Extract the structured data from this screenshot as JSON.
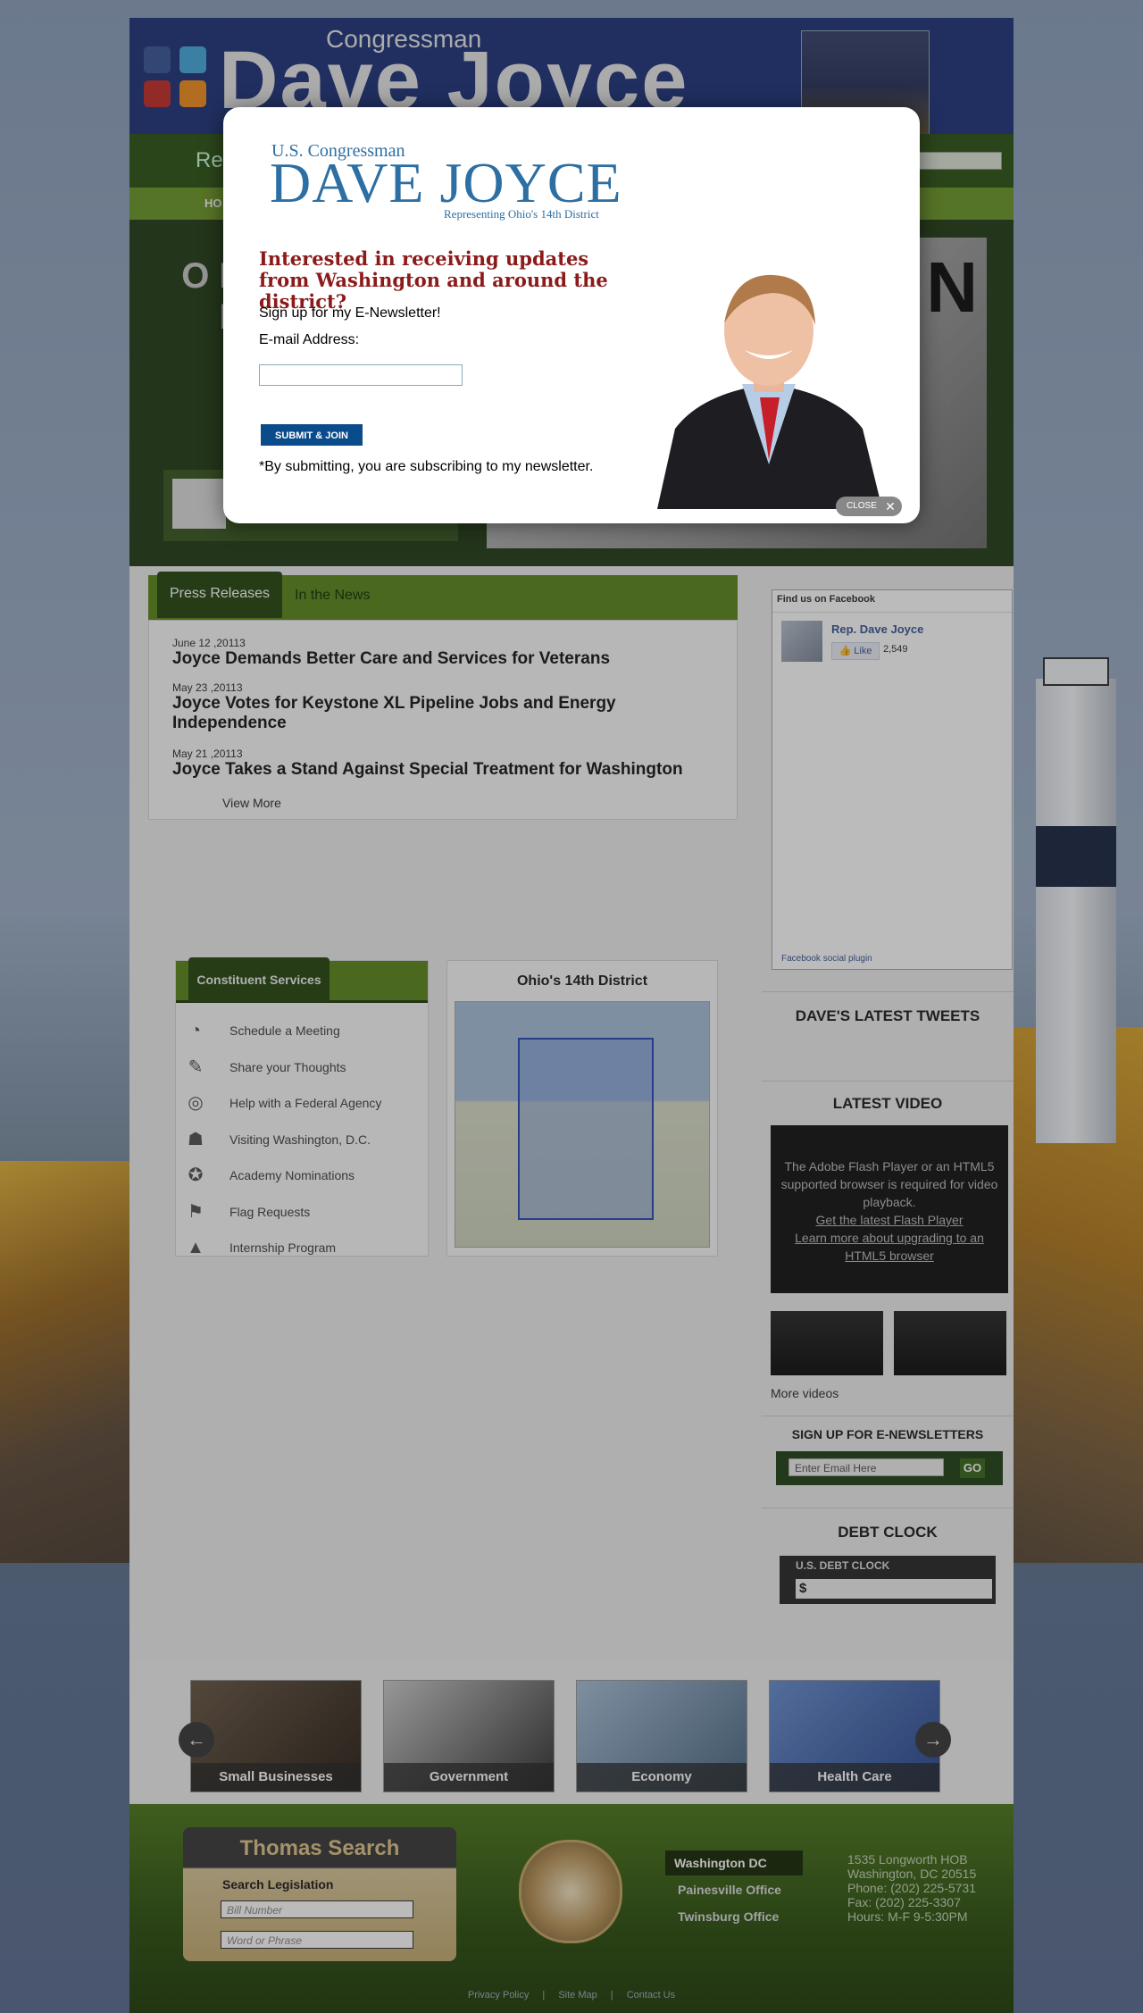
{
  "header": {
    "congressman_small": "Congressman",
    "congressman_big": "Dave Joyce",
    "greenbar_text": "Rep",
    "nav_home": "HO",
    "hero_text": "O DE S FA",
    "hero_big_letter": "N"
  },
  "social_icons": [
    "facebook-icon",
    "twitter-icon",
    "youtube-icon",
    "rss-icon"
  ],
  "press": {
    "tabs": [
      "Press Releases",
      "In the News"
    ],
    "releases": [
      {
        "date": "June 12 ,20113",
        "title": "Joyce Demands Better Care and Services for Veterans"
      },
      {
        "date": "May 23 ,20113",
        "title": "Joyce Votes for Keystone XL Pipeline Jobs and Energy Independence"
      },
      {
        "date": "May 21 ,20113",
        "title": "Joyce Takes a Stand Against Special Treatment for Washington"
      }
    ],
    "view_more": "View More"
  },
  "facebook": {
    "header": "Find us on Facebook",
    "name": "Rep. Dave Joyce",
    "like_label": "Like",
    "like_count": "2,549",
    "plugin": "Facebook social plugin"
  },
  "sidebar": {
    "tweets_heading": "DAVE'S LATEST TWEETS",
    "video_heading": "LATEST VIDEO",
    "flash_message": "The Adobe Flash Player or an HTML5 supported browser is required for video playback.",
    "flash_link1": "Get the latest Flash Player",
    "flash_link2": "Learn more about upgrading to an HTML5 browser",
    "more_videos": "More videos",
    "newsletter_heading": "SIGN UP FOR E-NEWSLETTERS",
    "newsletter_placeholder": "Enter Email Here",
    "newsletter_go": "GO",
    "debt_heading": "DEBT CLOCK",
    "debt_label": "U.S. DEBT CLOCK",
    "debt_value": "$"
  },
  "constituent": {
    "tab": "Constituent Services",
    "items": [
      {
        "icon": "calendar-icon",
        "glyph": "◔",
        "label": "Schedule a Meeting"
      },
      {
        "icon": "pen-icon",
        "glyph": "✎",
        "label": "Share your Thoughts"
      },
      {
        "icon": "lifebuoy-icon",
        "glyph": "◎",
        "label": "Help with a Federal Agency"
      },
      {
        "icon": "people-icon",
        "glyph": "☗",
        "label": "Visiting Washington, D.C."
      },
      {
        "icon": "medal-icon",
        "glyph": "✪",
        "label": "Academy Nominations"
      },
      {
        "icon": "flag-icon",
        "glyph": "⚑",
        "label": "Flag Requests"
      },
      {
        "icon": "graduation-cap-icon",
        "glyph": "▲",
        "label": "Internship Program"
      }
    ]
  },
  "map": {
    "title": "Ohio's 14th District"
  },
  "carousel": {
    "items": [
      "Small Businesses",
      "Government",
      "Economy",
      "Health Care"
    ],
    "prev": "←",
    "next": "→"
  },
  "footer": {
    "thomas_title": "Thomas Search",
    "search_label": "Search Legislation",
    "bill_placeholder": "Bill Number",
    "word_placeholder": "Word or Phrase",
    "offices": [
      "Washington DC",
      "Painesville Office",
      "Twinsburg Office"
    ],
    "address_lines": [
      "1535 Longworth HOB",
      "Washington, DC 20515",
      "Phone: (202) 225-5731",
      "Fax: (202) 225-3307",
      "Hours: M-F 9-5:30PM"
    ],
    "links": [
      "Privacy Policy",
      "Site Map",
      "Contact Us"
    ],
    "link_sep": "|"
  },
  "modal": {
    "congressman": "U.S. Congressman",
    "name": "DAVE JOYCE",
    "district": "Representing Ohio's 14th District",
    "headline": "Interested in receiving updates from Washington and around the district?",
    "signup_text": "Sign up for my E-Newsletter!",
    "email_label": "E-mail Address:",
    "submit": "SUBMIT & JOIN",
    "disclaimer": "*By submitting, you are subscribing to my newsletter.",
    "close": "CLOSE"
  }
}
